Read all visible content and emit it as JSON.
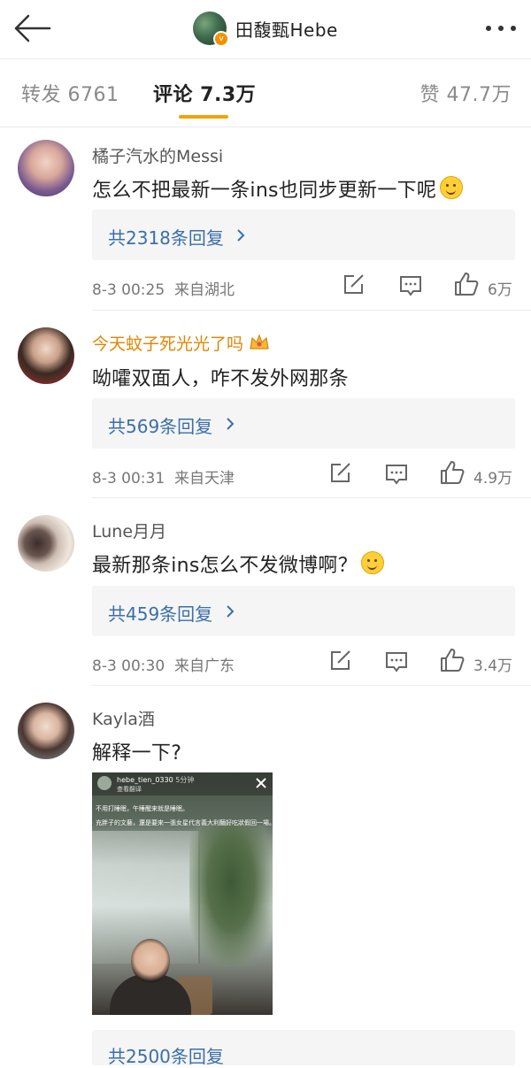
{
  "header": {
    "title": "田馥甄Hebe"
  },
  "tabs": {
    "repost": "转发 6761",
    "comments": "评论 7.3万",
    "likes": "赞 47.7万"
  },
  "comments": [
    {
      "username": "橘子汽水的Messi",
      "text": "怎么不把最新一条ins也同步更新一下呢",
      "replies": "共2318条回复",
      "time": "8-3 00:25",
      "location": "来自湖北",
      "likes": "6万"
    },
    {
      "username": "今天蚊子死光光了吗",
      "text": "呦嚯双面人，咋不发外网那条",
      "replies": "共569条回复",
      "time": "8-3 00:31",
      "location": "来自天津",
      "likes": "4.9万"
    },
    {
      "username": "Lune月月",
      "text": "最新那条ins怎么不发微博啊？",
      "replies": "共459条回复",
      "time": "8-3 00:30",
      "location": "来自广东",
      "likes": "3.4万"
    },
    {
      "username": "Kayla酒",
      "text": "解释一下?",
      "image": {
        "user": "hebe_tien_0330",
        "time": "5分钟",
        "translate": "查看翻译",
        "line1": "不用打睡眠，午睡醒来就是睡眠。",
        "line2": "充胖子的文藝，還是要來一張女星代言義大利麵好吃狀假回一場。"
      },
      "replies": "共2500条回复"
    }
  ],
  "colors": {
    "accent": "#f2a20b",
    "link": "#3b6fa8",
    "vip_name": "#e08600"
  }
}
